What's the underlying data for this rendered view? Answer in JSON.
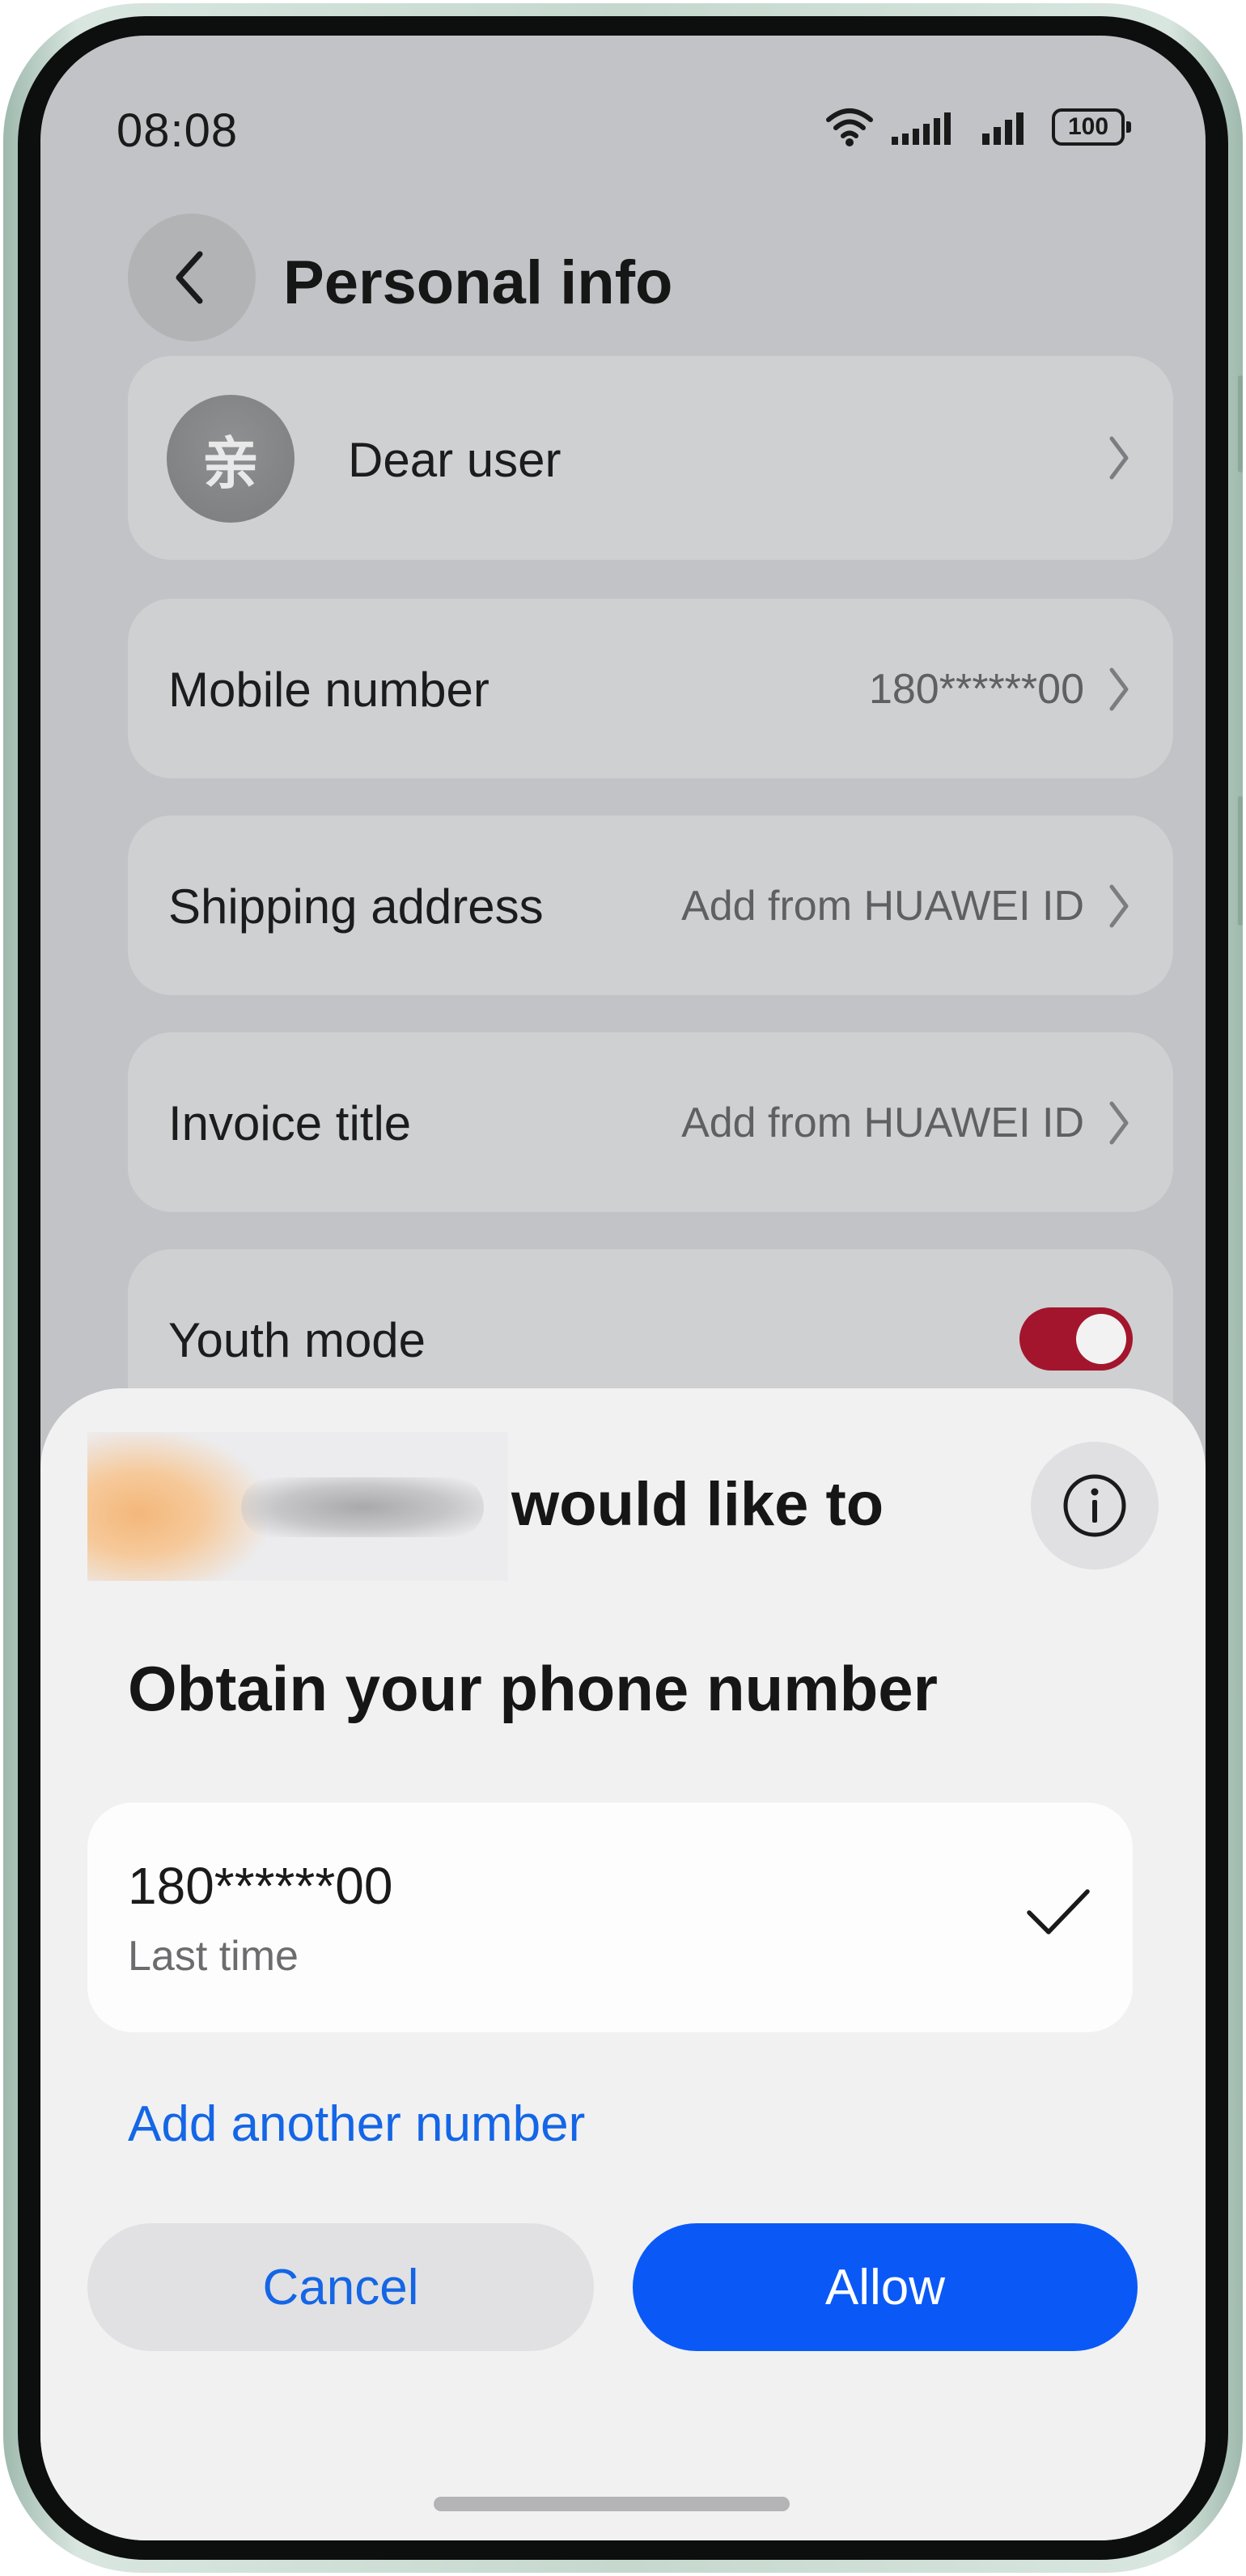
{
  "status_bar": {
    "time": "08:08",
    "battery": "100",
    "icons": [
      "wifi-icon",
      "signal-icon",
      "signal-icon",
      "battery-icon"
    ]
  },
  "header": {
    "back_icon": "chevron-left-icon",
    "title": "Personal info"
  },
  "list": {
    "profile": {
      "avatar_text": "亲",
      "name": "Dear user"
    },
    "mobile": {
      "label": "Mobile number",
      "value": "180******00"
    },
    "shipping": {
      "label": "Shipping address",
      "value": "Add from HUAWEI ID"
    },
    "invoice": {
      "label": "Invoice title",
      "value": "Add from HUAWEI ID"
    },
    "youth": {
      "label": "Youth mode",
      "toggle_on": true
    }
  },
  "sheet": {
    "requester_suffix": "would like to",
    "info_icon": "info-icon",
    "title": "Obtain your phone number",
    "number_option": {
      "number": "180******00",
      "note": "Last time",
      "selected": true
    },
    "add_link": "Add another number",
    "cancel_label": "Cancel",
    "allow_label": "Allow"
  },
  "colors": {
    "accent_blue": "#0A59F7",
    "link_blue": "#1466E6",
    "toggle_red": "#A3152D"
  }
}
